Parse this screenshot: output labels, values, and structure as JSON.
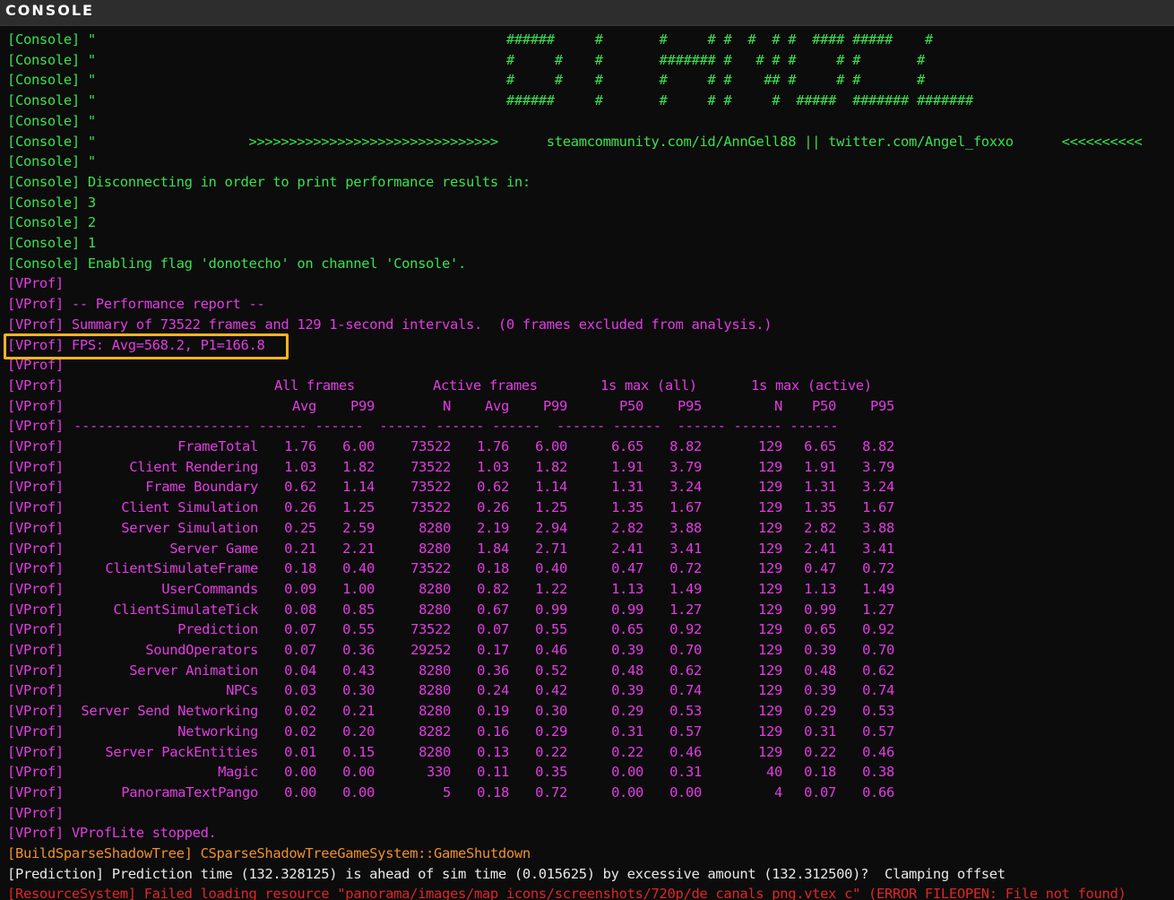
{
  "window": {
    "title": "CONSOLE"
  },
  "colors": {
    "green": "#39e14f",
    "magenta": "#e13ce1",
    "orange": "#f0902a",
    "white": "#e8e8e8",
    "red": "#e02525",
    "highlight": "#f5b51d"
  },
  "console_lines": [
    {
      "tag": "[Console]",
      "text": " \"                                                   ######     #       #     # #  #  # #  #### #####    #"
    },
    {
      "tag": "[Console]",
      "text": " \"                                                   #     #    #       ####### #   # # #     # #       #"
    },
    {
      "tag": "[Console]",
      "text": " \"                                                   #     #    #       #     # #    ## #     # #       #"
    },
    {
      "tag": "[Console]",
      "text": " \"                                                   ######     #       #     # #     #  #####  ####### #######"
    },
    {
      "tag": "[Console]",
      "text": " \""
    },
    {
      "tag": "[Console]",
      "text": " \"                   >>>>>>>>>>>>>>>>>>>>>>>>>>>>>>>      steamcommunity.com/id/AnnGell88 || twitter.com/Angel_foxxo      <<<<<<<<<<"
    },
    {
      "tag": "[Console]",
      "text": " \""
    },
    {
      "tag": "[Console]",
      "text": " Disconnecting in order to print performance results in:"
    },
    {
      "tag": "[Console]",
      "text": " 3"
    },
    {
      "tag": "[Console]",
      "text": " 2"
    },
    {
      "tag": "[Console]",
      "text": " 1"
    },
    {
      "tag": "[Console]",
      "text": " Enabling flag 'donotecho' on channel 'Console'."
    }
  ],
  "vprof_header_lines": [
    {
      "tag": "[VProf]",
      "text": ""
    },
    {
      "tag": "[VProf]",
      "text": " -- Performance report --"
    },
    {
      "tag": "[VProf]",
      "text": " Summary of 73522 frames and 129 1-second intervals.  (0 frames excluded from analysis.)"
    },
    {
      "tag": "[VProf]",
      "text": " FPS: Avg=568.2, P1=166.8"
    },
    {
      "tag": "[VProf]",
      "text": ""
    }
  ],
  "vprof_table": {
    "tag": "[VProf]",
    "group_headers": [
      "All frames",
      "Active frames",
      "1s max (all)",
      "1s max (active)"
    ],
    "column_headers": [
      "Avg",
      "P99",
      "N",
      "Avg",
      "P99",
      "P50",
      "P95",
      "N",
      "P50",
      "P95"
    ],
    "separator": "---------------------- ------ ------  ------ ------ ------  ------ ------  ------ ------ ------",
    "rows": [
      {
        "name": "FrameTotal",
        "values": [
          "1.76",
          "6.00",
          "73522",
          "1.76",
          "6.00",
          "6.65",
          "8.82",
          "129",
          "6.65",
          "8.82"
        ]
      },
      {
        "name": "Client Rendering",
        "values": [
          "1.03",
          "1.82",
          "73522",
          "1.03",
          "1.82",
          "1.91",
          "3.79",
          "129",
          "1.91",
          "3.79"
        ]
      },
      {
        "name": "Frame Boundary",
        "values": [
          "0.62",
          "1.14",
          "73522",
          "0.62",
          "1.14",
          "1.31",
          "3.24",
          "129",
          "1.31",
          "3.24"
        ]
      },
      {
        "name": "Client Simulation",
        "values": [
          "0.26",
          "1.25",
          "73522",
          "0.26",
          "1.25",
          "1.35",
          "1.67",
          "129",
          "1.35",
          "1.67"
        ]
      },
      {
        "name": "Server Simulation",
        "values": [
          "0.25",
          "2.59",
          "8280",
          "2.19",
          "2.94",
          "2.82",
          "3.88",
          "129",
          "2.82",
          "3.88"
        ]
      },
      {
        "name": "Server Game",
        "values": [
          "0.21",
          "2.21",
          "8280",
          "1.84",
          "2.71",
          "2.41",
          "3.41",
          "129",
          "2.41",
          "3.41"
        ]
      },
      {
        "name": "ClientSimulateFrame",
        "values": [
          "0.18",
          "0.40",
          "73522",
          "0.18",
          "0.40",
          "0.47",
          "0.72",
          "129",
          "0.47",
          "0.72"
        ]
      },
      {
        "name": "UserCommands",
        "values": [
          "0.09",
          "1.00",
          "8280",
          "0.82",
          "1.22",
          "1.13",
          "1.49",
          "129",
          "1.13",
          "1.49"
        ]
      },
      {
        "name": "ClientSimulateTick",
        "values": [
          "0.08",
          "0.85",
          "8280",
          "0.67",
          "0.99",
          "0.99",
          "1.27",
          "129",
          "0.99",
          "1.27"
        ]
      },
      {
        "name": "Prediction",
        "values": [
          "0.07",
          "0.55",
          "73522",
          "0.07",
          "0.55",
          "0.65",
          "0.92",
          "129",
          "0.65",
          "0.92"
        ]
      },
      {
        "name": "SoundOperators",
        "values": [
          "0.07",
          "0.36",
          "29252",
          "0.17",
          "0.46",
          "0.39",
          "0.70",
          "129",
          "0.39",
          "0.70"
        ]
      },
      {
        "name": "Server Animation",
        "values": [
          "0.04",
          "0.43",
          "8280",
          "0.36",
          "0.52",
          "0.48",
          "0.62",
          "129",
          "0.48",
          "0.62"
        ]
      },
      {
        "name": "NPCs",
        "values": [
          "0.03",
          "0.30",
          "8280",
          "0.24",
          "0.42",
          "0.39",
          "0.74",
          "129",
          "0.39",
          "0.74"
        ]
      },
      {
        "name": "Server Send Networking",
        "values": [
          "0.02",
          "0.21",
          "8280",
          "0.19",
          "0.30",
          "0.29",
          "0.53",
          "129",
          "0.29",
          "0.53"
        ]
      },
      {
        "name": "Networking",
        "values": [
          "0.02",
          "0.20",
          "8282",
          "0.16",
          "0.29",
          "0.31",
          "0.57",
          "129",
          "0.31",
          "0.57"
        ]
      },
      {
        "name": "Server PackEntities",
        "values": [
          "0.01",
          "0.15",
          "8280",
          "0.13",
          "0.22",
          "0.22",
          "0.46",
          "129",
          "0.22",
          "0.46"
        ]
      },
      {
        "name": "Magic",
        "values": [
          "0.00",
          "0.00",
          "330",
          "0.11",
          "0.35",
          "0.00",
          "0.31",
          "40",
          "0.18",
          "0.38"
        ]
      },
      {
        "name": "PanoramaTextPango",
        "values": [
          "0.00",
          "0.00",
          "5",
          "0.18",
          "0.72",
          "0.00",
          "0.00",
          "4",
          "0.07",
          "0.66"
        ]
      }
    ]
  },
  "footer_lines": [
    {
      "color": "magenta",
      "text": "[VProf]"
    },
    {
      "color": "magenta",
      "text": "[VProf] VProfLite stopped."
    },
    {
      "color": "orange",
      "text": "[BuildSparseShadowTree] CSparseShadowTreeGameSystem::GameShutdown"
    },
    {
      "color": "white",
      "text": "[Prediction] Prediction time (132.328125) is ahead of sim time (0.015625) by excessive amount (132.312500)?  Clamping offset"
    },
    {
      "color": "red",
      "text": "[ResourceSystem] Failed loading resource \"panorama/images/map_icons/screenshots/720p/de_canals_png.vtex_c\" (ERROR_FILEOPEN: File not found)"
    }
  ]
}
